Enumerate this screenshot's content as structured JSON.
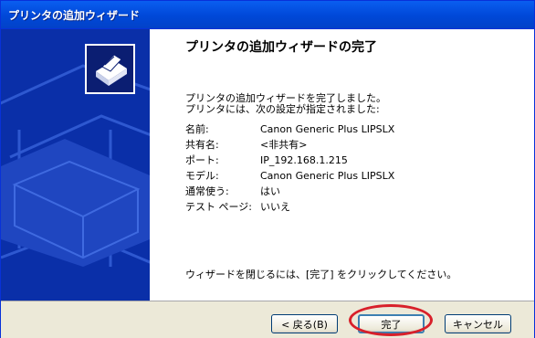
{
  "window": {
    "title": "プリンタの追加ウィザード"
  },
  "heading": "プリンタの追加ウィザードの完了",
  "intro": [
    "プリンタの追加ウィザードを完了しました。",
    "プリンタには、次の設定が指定されました:"
  ],
  "settings": [
    {
      "label": "名前:",
      "value": "Canon Generic Plus LIPSLX"
    },
    {
      "label": "共有名:",
      "value": "<非共有>"
    },
    {
      "label": "ポート:",
      "value": "IP_192.168.1.215"
    },
    {
      "label": "モデル:",
      "value": "Canon Generic Plus LIPSLX"
    },
    {
      "label": "通常使う:",
      "value": "はい"
    },
    {
      "label": "テスト ページ:",
      "value": "いいえ"
    }
  ],
  "footer_note": "ウィザードを閉じるには、[完了] をクリックしてください。",
  "buttons": {
    "back": "< 戻る(B)",
    "finish": "完了",
    "cancel": "キャンセル"
  },
  "icons": {
    "wizard": "printer-icon"
  },
  "colors": {
    "titlebar": "#0a5ef0",
    "sidebar": "#0a2fa8",
    "highlight": "#d8202a"
  }
}
